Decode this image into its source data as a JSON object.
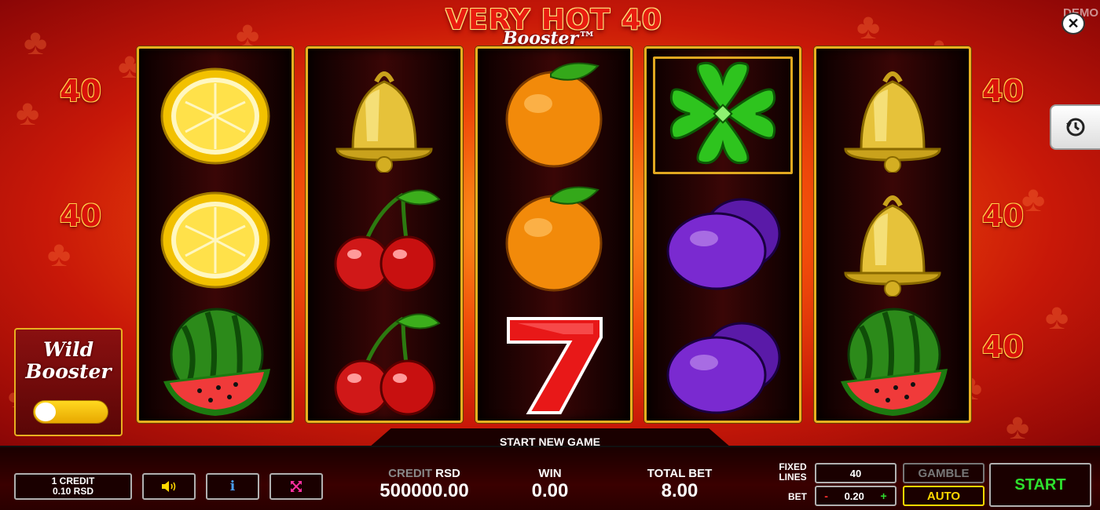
{
  "header": {
    "title": "VERY HOT 40",
    "subtitle": "Booster™",
    "demo_label": "DEMO",
    "close_icon": "close-icon",
    "history_icon": "history-icon"
  },
  "paylines": {
    "left": [
      "40",
      "40",
      "40"
    ],
    "right": [
      "40",
      "40",
      "40"
    ]
  },
  "reels": [
    [
      "lemon",
      "lemon",
      "watermelon"
    ],
    [
      "bell",
      "cherry",
      "cherry"
    ],
    [
      "orange",
      "orange",
      "seven"
    ],
    [
      "clover",
      "plum",
      "plum"
    ],
    [
      "bell",
      "bell",
      "watermelon"
    ]
  ],
  "highlighted_cell": {
    "reel": 3,
    "row": 0
  },
  "wild_booster": {
    "title_line1": "Wild",
    "title_line2": "Booster",
    "toggle_on": false
  },
  "message": "START NEW GAME",
  "controls": {
    "credit_denom_line1": "1 CREDIT",
    "credit_denom_line2": "0.10 RSD",
    "sound_icon": "speaker-icon",
    "info_icon": "info-icon",
    "fullscreen_icon": "fullscreen-icon",
    "credit_label": "CREDIT",
    "credit_currency": "RSD",
    "credit_value": "500000.00",
    "win_label": "WIN",
    "win_value": "0.00",
    "total_bet_label": "TOTAL BET",
    "total_bet_value": "8.00",
    "fixed_lines_label_1": "FIXED",
    "fixed_lines_label_2": "LINES",
    "lines_value": "40",
    "bet_label": "BET",
    "bet_minus": "-",
    "bet_value": "0.20",
    "bet_plus": "+",
    "gamble_label": "GAMBLE",
    "auto_label": "AUTO",
    "start_label": "START"
  },
  "colors": {
    "accent_gold": "#e8b020",
    "start_green": "#2ee02e",
    "auto_yellow": "#ffd800"
  }
}
